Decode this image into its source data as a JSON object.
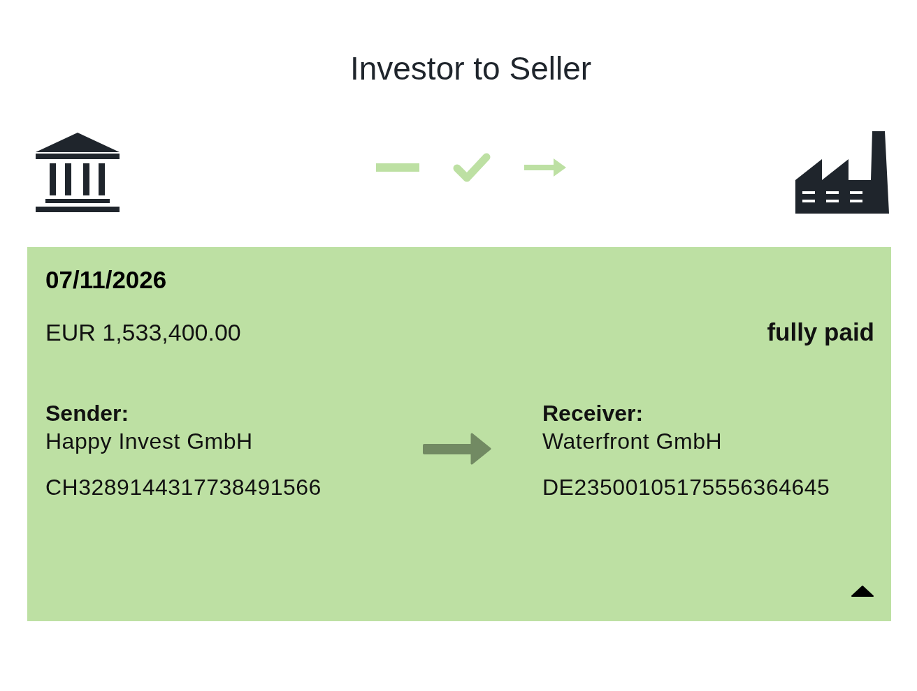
{
  "title": "Investor to Seller",
  "payment": {
    "date": "07/11/2026",
    "amount": "EUR 1,533,400.00",
    "status": "fully paid",
    "expanded": true,
    "sender": {
      "label": "Sender:",
      "name": "Happy Invest GmbH",
      "account": "CH3289144317738491566"
    },
    "receiver": {
      "label": "Receiver:",
      "name": "Waterfront GmbH",
      "account": "DE23500105175556364645"
    }
  }
}
